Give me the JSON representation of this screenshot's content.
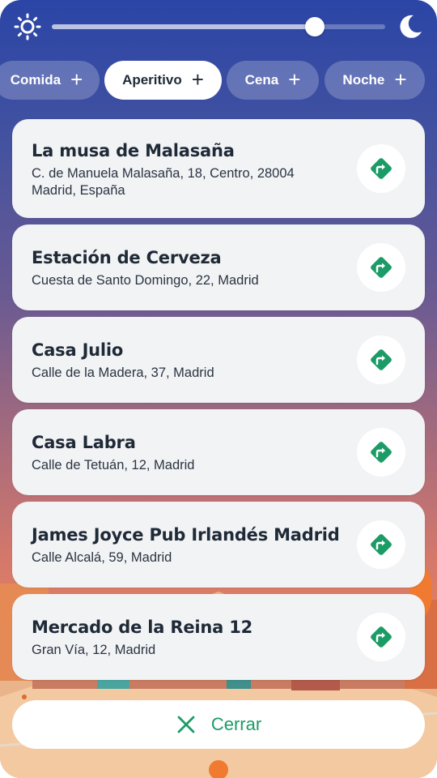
{
  "colors": {
    "accent_green": "#1b9c66",
    "card_bg": "#f2f3f5",
    "text_dark": "#1f2a37"
  },
  "time_slider": {
    "left_icon": "sun-icon",
    "right_icon": "moon-icon",
    "value_fraction": 0.79
  },
  "categories": [
    {
      "label": "Comida",
      "icon": "plus-icon",
      "selected": false
    },
    {
      "label": "Aperitivo",
      "icon": "plus-icon",
      "selected": true
    },
    {
      "label": "Cena",
      "icon": "plus-icon",
      "selected": false
    },
    {
      "label": "Noche",
      "icon": "plus-icon",
      "selected": false
    }
  ],
  "places": [
    {
      "name": "La musa de Malasaña",
      "address": "C. de Manuela Malasaña, 18, Centro, 28004 Madrid, España",
      "icon": "directions-icon"
    },
    {
      "name": "Estación de Cerveza",
      "address": "Cuesta de Santo Domingo, 22, Madrid",
      "icon": "directions-icon"
    },
    {
      "name": "Casa Julio",
      "address": "Calle de la Madera, 37, Madrid",
      "icon": "directions-icon"
    },
    {
      "name": "Casa Labra",
      "address": "Calle de Tetuán, 12, Madrid",
      "icon": "directions-icon"
    },
    {
      "name": "James Joyce Pub Irlandés Madrid",
      "address": "Calle Alcalá, 59, Madrid",
      "icon": "directions-icon"
    },
    {
      "name": "Mercado de la Reina 12",
      "address": "Gran Vía, 12, Madrid",
      "icon": "directions-icon"
    }
  ],
  "close_button": {
    "label": "Cerrar",
    "icon": "close-icon"
  }
}
